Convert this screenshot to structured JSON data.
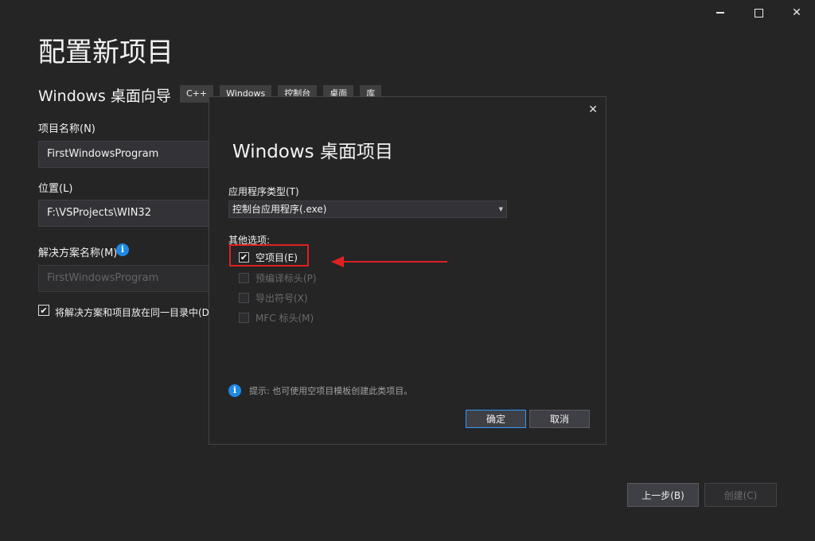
{
  "window": {
    "minimize_icon": "minimize-icon",
    "maximize_icon": "maximize-icon",
    "close_icon": "close-icon",
    "close_glyph": "✕"
  },
  "page": {
    "title": "配置新项目",
    "subtitle": "Windows 桌面向导",
    "tags": [
      "C++",
      "Windows",
      "控制台",
      "桌面",
      "库"
    ]
  },
  "form": {
    "project_name_label": "项目名称(N)",
    "project_name_value": "FirstWindowsProgram",
    "location_label": "位置(L)",
    "location_value": "F:\\VSProjects\\WIN32",
    "solution_name_label": "解决方案名称(M)",
    "solution_name_value": "FirstWindowsProgram",
    "info_glyph": "i",
    "same_dir_checkbox_label": "将解决方案和项目放在同一目录中(D",
    "same_dir_checked": true,
    "check_glyph": "✔"
  },
  "footer": {
    "prev_button": "上一步(B)",
    "create_button": "创建(C)"
  },
  "dialog": {
    "close_glyph": "✕",
    "title": "Windows 桌面项目",
    "app_type_label": "应用程序类型(T)",
    "app_type_value": "控制台应用程序(.exe)",
    "dropdown_glyph": "▼",
    "other_options_label": "其他选项:",
    "options": [
      {
        "label": "空项目(E)",
        "checked": true,
        "enabled": true
      },
      {
        "label": "预编译标头(P)",
        "checked": false,
        "enabled": false
      },
      {
        "label": "导出符号(X)",
        "checked": false,
        "enabled": false
      },
      {
        "label": "MFC 标头(M)",
        "checked": false,
        "enabled": false
      }
    ],
    "hint_text": "提示: 也可使用空项目模板创建此类项目。",
    "ok_button": "确定",
    "cancel_button": "取消"
  },
  "colors": {
    "background": "#252526",
    "accent": "#3399ff",
    "annotation_red": "#e02020",
    "info_blue": "#1e88e5"
  }
}
